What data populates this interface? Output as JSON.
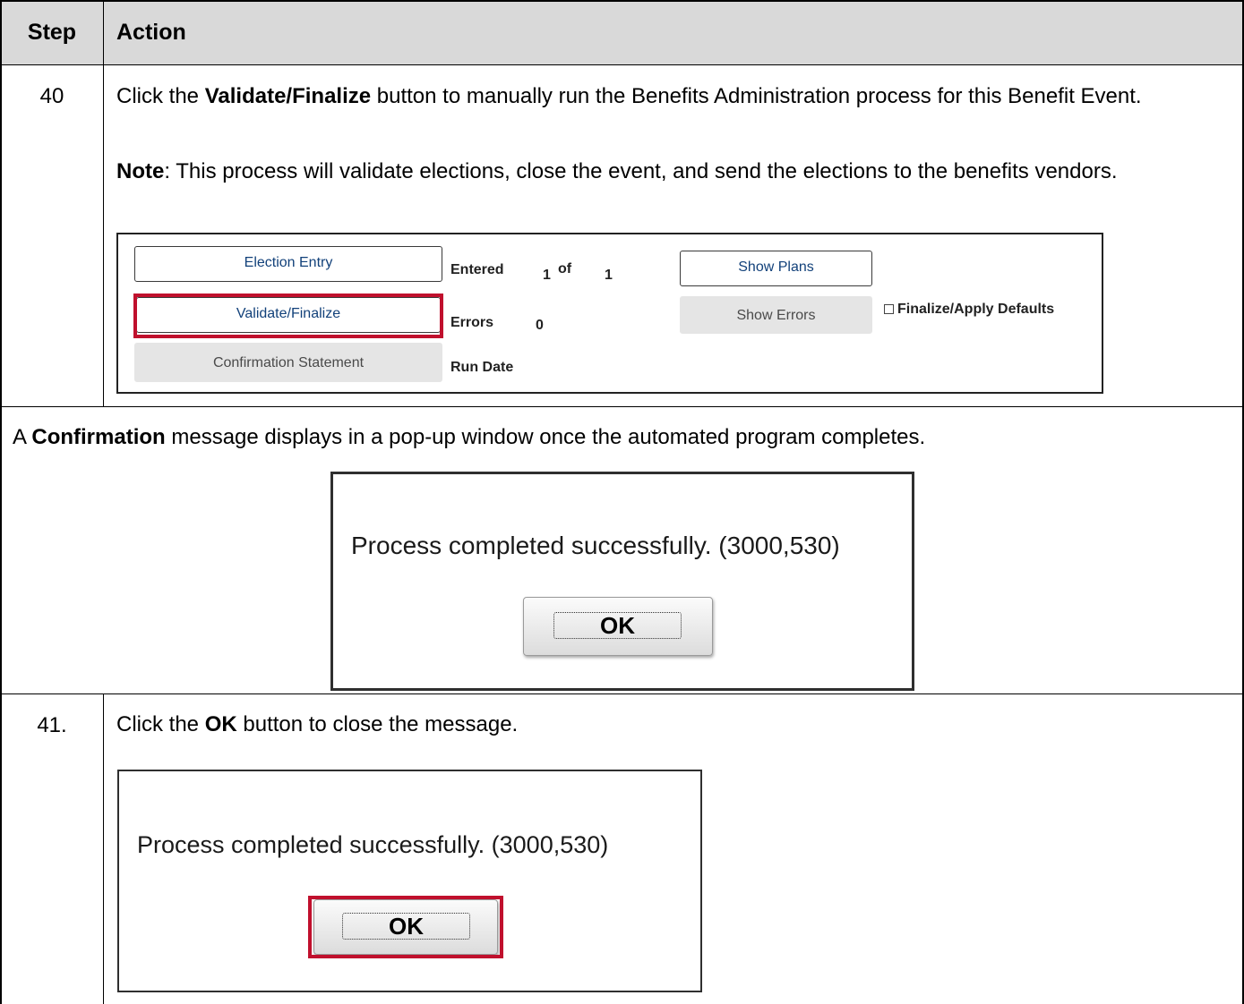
{
  "table": {
    "header": {
      "step": "Step",
      "action": "Action"
    },
    "row40": {
      "step": "40",
      "instruction": {
        "pre": "Click the ",
        "bold": "Validate/Finalize",
        "post": " button to manually run the Benefits Administration process for this Benefit Event."
      },
      "note": {
        "bold": "Note",
        "post": ": This process will validate elections, close the event, and send the elections to the benefits vendors."
      }
    },
    "confirmation_row": {
      "pre": "A ",
      "bold": "Confirmation",
      "post": " message displays in a pop-up window once the automated program completes."
    },
    "row41": {
      "step": "41.",
      "instruction": {
        "pre": "Click the ",
        "bold": "OK",
        "post": " button to close the message."
      }
    }
  },
  "screenshot": {
    "election_entry_button": "Election Entry",
    "validate_finalize_button": "Validate/Finalize",
    "confirmation_statement_button": "Confirmation Statement",
    "entered_label": "Entered",
    "entered_count": "1",
    "of_label": "of",
    "entered_total": "1",
    "errors_label": "Errors",
    "errors_count": "0",
    "run_date_label": "Run Date",
    "show_plans_button": "Show Plans",
    "show_errors_button": "Show Errors",
    "finalize_defaults_checkbox": "Finalize/Apply Defaults",
    "finalize_defaults_checked": false
  },
  "dialog": {
    "message": "Process completed successfully. (3000,530)",
    "ok_label": "OK"
  },
  "colors": {
    "header_bg": "#d9d9d9",
    "highlight": "#c0102d",
    "link_blue": "#12417a"
  }
}
